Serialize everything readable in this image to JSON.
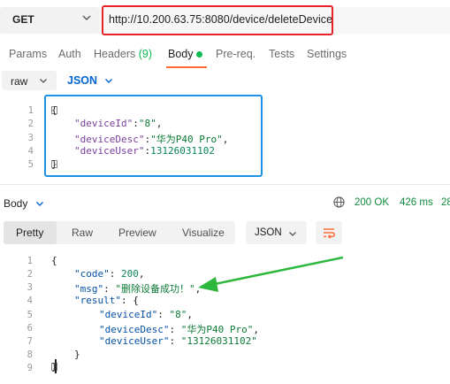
{
  "request": {
    "method": "GET",
    "url": "http://10.200.63.75:8080/device/deleteDevice"
  },
  "tabs": [
    {
      "label": "Params"
    },
    {
      "label": "Auth"
    },
    {
      "label": "Headers",
      "count": "(9)"
    },
    {
      "label": "Body"
    },
    {
      "label": "Pre-req."
    },
    {
      "label": "Tests"
    },
    {
      "label": "Settings"
    }
  ],
  "body_mode": {
    "type": "raw",
    "format": "JSON"
  },
  "request_body": {
    "line_numbers": [
      "1",
      "2",
      "3",
      "4",
      "5"
    ],
    "open_brace": "{",
    "close_brace": "}",
    "fields": [
      {
        "key": "\"deviceId\"",
        "value": "\"8\"",
        "trail": ","
      },
      {
        "key": "\"deviceDesc\"",
        "value": "\"华为P40 Pro\"",
        "trail": ","
      },
      {
        "key": "\"deviceUser\"",
        "value": "13126031102",
        "trail": ""
      }
    ]
  },
  "response": {
    "label": "Body",
    "status": "200 OK",
    "time": "426 ms",
    "size": "28",
    "views": [
      "Pretty",
      "Raw",
      "Preview",
      "Visualize"
    ],
    "format": "JSON",
    "line_numbers": [
      "1",
      "2",
      "3",
      "4",
      "5",
      "6",
      "7",
      "8",
      "9"
    ],
    "open_brace": "{",
    "code_key": "\"code\"",
    "code_value": "200",
    "msg_key": "\"msg\"",
    "msg_value": "\"删除设备成功！\"",
    "result_key": "\"result\"",
    "result_open": "{",
    "result_fields": [
      {
        "key": "\"deviceId\"",
        "value": "\"8\"",
        "trail": ","
      },
      {
        "key": "\"deviceDesc\"",
        "value": "\"华为P40 Pro\"",
        "trail": ","
      },
      {
        "key": "\"deviceUser\"",
        "value": "\"13126031102\"",
        "trail": ""
      }
    ],
    "result_close": "}",
    "close_brace": "}"
  },
  "colors": {
    "url_highlight": "#e8222b",
    "request_highlight": "#1e90e6",
    "arrow": "#2db83d",
    "accent": "#ff6c37"
  }
}
